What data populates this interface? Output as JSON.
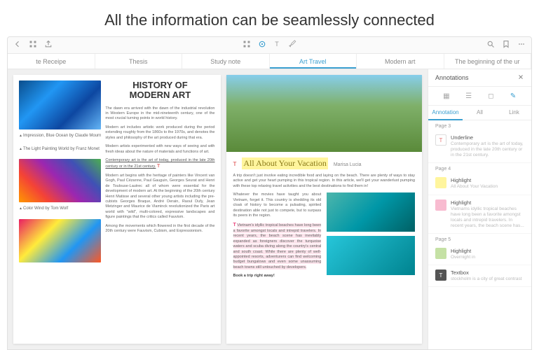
{
  "promo": {
    "headline": "All the information can be seamlessly connected"
  },
  "tabs": [
    {
      "label": "te Receipe"
    },
    {
      "label": "Thesis"
    },
    {
      "label": "Study note"
    },
    {
      "label": "Art Travel",
      "active": true
    },
    {
      "label": "Modern art"
    },
    {
      "label": "The beginning of the ur"
    }
  ],
  "page_left": {
    "title_line1": "HISTORY OF",
    "title_line2": "MODERN ART",
    "p1": "The dawn era arrived with the dawn of the industrial revolution in Western Europe in the mid-nineteenth century, one of the most crucial turning points in world history.",
    "p2": "Modern art includes artistic work produced during the period extending roughly from the 1860s to the 1970s, and denotes the styles and philosophy of the art produced during that era.",
    "p3": "Modern artists experimented with new ways of seeing and with fresh ideas about the nature of materials and functions of art.",
    "underlined": "Contemporary art is the art of today, produced in the late 20th century or in the 21st century.",
    "p4": "Modern art begins with the heritage of painters like Vincent van Gogh, Paul Cézanne, Paul Gauguin, Georges Seurat and Henri de Toulouse-Lautrec all of whom were essential for the development of modern art. At the beginning of the 20th century Henri Matisse and several other young artists including the pre-cubists Georges Braque, André Derain, Raoul Dufy, Jean Metzinger and Maurice de Vlaminck revolutionized the Paris art world with \"wild\", multi-colored, expressive landscapes and figure paintings that the critics called Fauvism.",
    "p5": "Among the movements which flowered in the first decade of the 20th century were Fauvism, Cubism, and Expressionism.",
    "cap1": "Impression, Blue Ocean by Claude Mourn",
    "cap2": "The Light Painting World by Franz Monet",
    "cap3": "Color Wind by Tom Wolf"
  },
  "page_right": {
    "vacation_title": "All About Your Vacation",
    "author": "Marisa Lucia",
    "p1": "A trip doesn't just involve eating incredible food and laying on the beach. There are plenty of ways to stay active and get your heart pumping in this tropical region. In this article, we'll get your wanderlust pumping with these top relaxing travel activities and the best destinations to find them in!",
    "p2": "Whatever the movies have taught you about Vietnam, forget it. This country is shedding its old cloak of history to become a pulsating, spirited destination able not just to compete, but to surpass its peers in the region.",
    "p3_hl": "Vietnam's idyllic tropical beaches have long been a favorite amongst locals and intrepid travelers. In recent years, the beach scene has inevitably expanded as foreigners discover the turquoise waters and scuba diving along the country's central and south coast. While there are plenty of well-appointed resorts, adventurers can find welcoming budget bungalows and even some unassuming beach towns still untouched by developers.",
    "cta": "Book a trip right away!"
  },
  "annotations": {
    "title": "Annotations",
    "filters": {
      "annotation": "Annotation",
      "all": "All",
      "link": "Link"
    },
    "groups": [
      {
        "page": "Page 3",
        "items": [
          {
            "type": "Underline",
            "preview": "Contemporary art is the art of today, produced in the late 20th century or in the 21st century.",
            "swatch": "underline"
          }
        ]
      },
      {
        "page": "Page 4",
        "items": [
          {
            "type": "Highlight",
            "preview": "All About Your Vacation",
            "swatch": "yellow"
          },
          {
            "type": "Highlight",
            "preview": "Vietnams idyllic tropical beaches have long been a favorite amongst locals and intrepid travelers. In recent years, the beach scene has...",
            "swatch": "pink"
          }
        ]
      },
      {
        "page": "Page 5",
        "items": [
          {
            "type": "Highlight",
            "preview": "Overnight in",
            "swatch": "green"
          },
          {
            "type": "Textbox",
            "preview": "stockholm is a city of great contrast",
            "swatch": "text"
          }
        ]
      }
    ]
  }
}
